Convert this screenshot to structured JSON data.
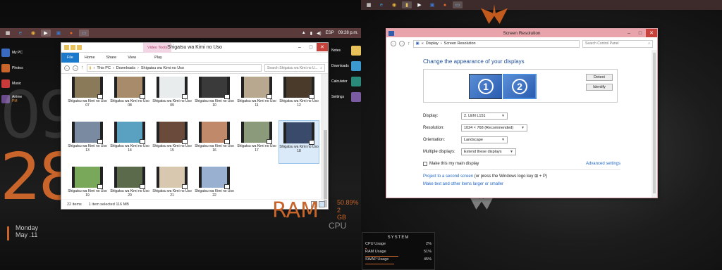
{
  "monitor1": {
    "taskbar": {
      "language": "ESP",
      "time": "09:28 p.m."
    },
    "desktop_icons": [
      {
        "label": "My PC",
        "sub": ""
      },
      {
        "label": "Photos",
        "sub": ""
      },
      {
        "label": "Music",
        "sub": ""
      },
      {
        "label": "Anime",
        "sub": "PM"
      }
    ],
    "clock": {
      "hour": "09",
      "minute": "28",
      "day": "Monday",
      "date": "May .11"
    },
    "launcher": [
      "Notes",
      "Downloads",
      "Calculator",
      "Settings"
    ],
    "ram": {
      "label": "RAM",
      "percent": "50.89%",
      "size": "2 GB"
    },
    "cpu": {
      "label": "CPU",
      "value": "2"
    }
  },
  "explorer": {
    "title": "Shigatsu wa Kimi no Uso",
    "context_tab": "Video Tools",
    "ribbon_tabs": [
      "File",
      "Home",
      "Share",
      "View",
      "Play"
    ],
    "breadcrumb": [
      "This PC",
      "Downloads",
      "Shigatsu wa Kimi no Uso"
    ],
    "search_placeholder": "Search Shigatsu wa Kimi no U...",
    "items": [
      {
        "label": "Shigatsu wa Kimi no Uso 07",
        "color": "#8a7a5a"
      },
      {
        "label": "Shigatsu wa Kimi no Uso 08",
        "color": "#a88b6b"
      },
      {
        "label": "Shigatsu wa Kimi no Uso 09",
        "color": "#e8ecec"
      },
      {
        "label": "Shigatsu wa Kimi no Uso 10",
        "color": "#3a3a3a"
      },
      {
        "label": "Shigatsu wa Kimi no Uso 11",
        "color": "#b8a890"
      },
      {
        "label": "Shigatsu wa Kimi no Uso 12",
        "color": "#4a3a2a"
      },
      {
        "label": "Shigatsu wa Kimi no Uso 13",
        "color": "#7a8aa0"
      },
      {
        "label": "Shigatsu wa Kimi no Uso 14",
        "color": "#5aa0c0"
      },
      {
        "label": "Shigatsu wa Kimi no Uso 15",
        "color": "#6a4a3a"
      },
      {
        "label": "Shigatsu wa Kimi no Uso 16",
        "color": "#c08a6a"
      },
      {
        "label": "Shigatsu wa Kimi no Uso 17",
        "color": "#8a9a7a"
      },
      {
        "label": "Shigatsu wa Kimi no Uso 18",
        "color": "#3a4a6a"
      },
      {
        "label": "Shigatsu wa Kimi no Uso 19",
        "color": "#7aa85a"
      },
      {
        "label": "Shigatsu wa Kimi no Uso 20",
        "color": "#5a6a4a"
      },
      {
        "label": "Shigatsu wa Kimi no Uso 21",
        "color": "#d8c8b0"
      },
      {
        "label": "Shigatsu wa Kimi no Uso 22",
        "color": "#9ab0d0"
      }
    ],
    "selected_index": 11,
    "status": {
      "count": "22 items",
      "selection": "1 item selected  116 MB"
    }
  },
  "screen_resolution": {
    "title": "Screen Resolution",
    "breadcrumb": [
      "Display",
      "Screen Resolution"
    ],
    "search_placeholder": "Search Control Panel",
    "heading": "Change the appearance of your displays",
    "monitors": [
      "1",
      "2"
    ],
    "detect_label": "Detect",
    "identify_label": "Identify",
    "display_label": "Display:",
    "display_value": "2. LEN L151",
    "resolution_label": "Resolution:",
    "resolution_value": "1024 × 768 (Recommended)",
    "orientation_label": "Orientation:",
    "orientation_value": "Landscape",
    "multiple_label": "Multiple displays:",
    "multiple_value": "Extend these displays",
    "main_display_label": "Make this my main display",
    "advanced_label": "Advanced settings",
    "project_link": "Project to a second screen",
    "project_suffix": " (or press the Windows logo key ",
    "project_end": " + P)",
    "text_link": "Make text and other items larger or smaller"
  },
  "system_widget": {
    "title": "SYSTEM",
    "rows": [
      {
        "label": "CPU Usage",
        "value": "2%",
        "fraction": 0.02
      },
      {
        "label": "RAM Usage",
        "value": "51%",
        "fraction": 0.51
      },
      {
        "label": "SWAP Usage",
        "value": "45%",
        "fraction": 0.45
      }
    ]
  }
}
